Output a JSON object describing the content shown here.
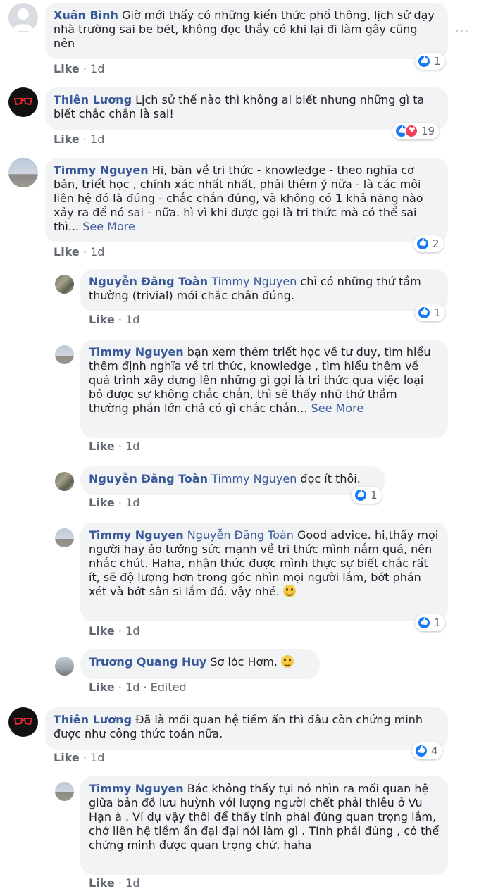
{
  "comments": [
    {
      "name": "Xuân Bình",
      "text": "Giờ mới thấy có những kiến thức phổ thông, lịch sử dạy nhà trường sai be bét, không đọc thầy có khi lại đi làm gây cũng nên",
      "like": "Like",
      "time": "1d",
      "reactions": "1"
    },
    {
      "name": "Thiên Lương",
      "text": "Lịch sử thế nào thì không ai biết nhưng những gì ta biết chắc chắn là sai!",
      "like": "Like",
      "time": "1d",
      "reactions": "19"
    },
    {
      "name": "Timmy Nguyen",
      "text": "Hi, bàn về tri thức - knowledge - theo nghĩa cơ bản, triết học , chính xác nhất nhất, phải thêm ý nữa - là các môi liên hệ đó là đúng - chắc chắn đúng, và không có 1 khả năng nào xảy ra để nó sai - nữa. hì vì khi được gọi là tri thức mà có thể sai thì...",
      "see_more": "See More",
      "like": "Like",
      "time": "1d",
      "reactions": "2"
    },
    {
      "name": "Nguyễn Đăng Toàn",
      "mention": "Timmy Nguyen",
      "text": "chỉ có những thứ tầm thường (trivial) mới chắc chắn đúng.",
      "like": "Like",
      "time": "1d",
      "reactions": "1"
    },
    {
      "name": "Timmy Nguyen",
      "text": "bạn xem thêm triết học về tư duy, tìm hiểu thêm định nghĩa về tri thức, knowledge , tìm hiểu thêm về quá trình xây dựng lên những gì gọi là tri thức qua việc loại bỏ được sự không chắc chắn, thì sẽ thấy nhữ thứ thầm thường phần lớn chả có gì chắc chắn...",
      "see_more": "See More",
      "like": "Like",
      "time": "1d"
    },
    {
      "name": "Nguyễn Đăng Toàn",
      "mention": "Timmy Nguyen",
      "text": "đọc ít thôi.",
      "like": "Like",
      "time": "1d",
      "reactions": "1"
    },
    {
      "name": "Timmy Nguyen",
      "mention": "Nguyễn Đăng Toàn",
      "text": "Good advice. hi,thấy mọi người hay ảo tưởng sức mạnh về tri thức mình nắm quá, nên nhắc chút. Haha, nhận thức được mình thực sự biết chắc rất ít, sẽ độ lượng hơn trong góc nhìn mọi người lắm, bớt phán xét và bớt sân si lắm đó. vậy nhé.",
      "like": "Like",
      "time": "1d",
      "reactions": "1"
    },
    {
      "name": "Trương Quang Huy",
      "text": "Sơ lóc Hơm.",
      "like": "Like",
      "time": "1d",
      "edited": "Edited"
    },
    {
      "name": "Thiên Lương",
      "text": "Đã là mối quan hệ tiềm ẩn thì đâu còn chứng minh được như công thức toán nữa.",
      "like": "Like",
      "time": "1d",
      "reactions": "4"
    },
    {
      "name": "Timmy Nguyen",
      "text": "Bác không thấy tụi nó nhìn ra mối quan hệ giữa bản đồ lưu huỳnh với lượng người chết phải thiêu ở Vu Hạn à . Ví dụ vậy thôi để thấy tính phải đúng quan trọng lắm, chớ liên hệ tiềm ẩn đại đại nói làm gì . Tính phải đúng , có thể chứng minh được quan trọng chứ. haha",
      "like": "Like",
      "time": "1d"
    }
  ],
  "sep": "·",
  "options": "···"
}
